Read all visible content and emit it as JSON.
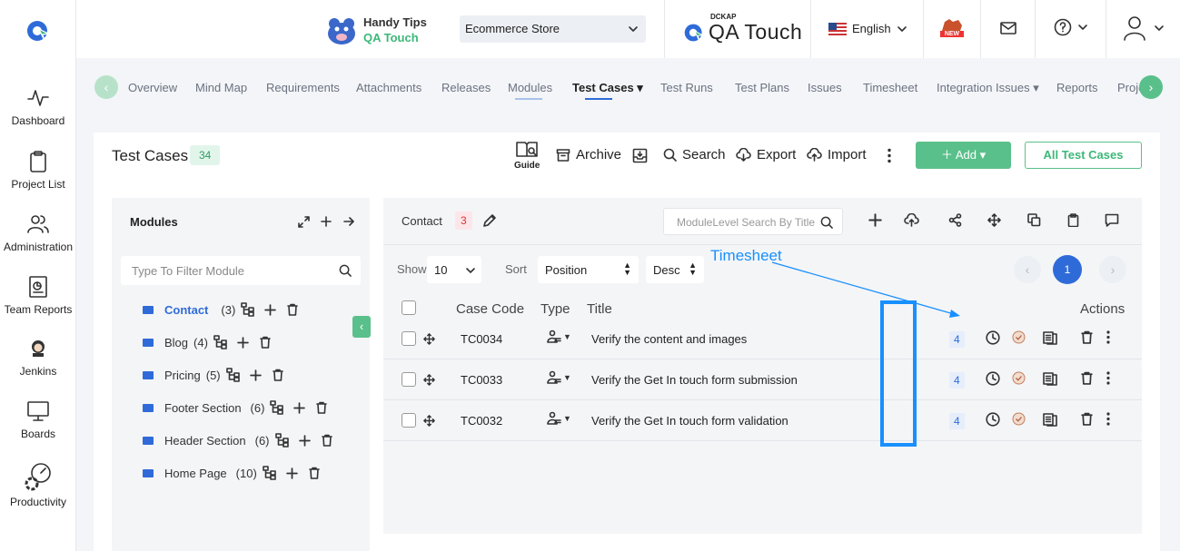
{
  "sidebar": {
    "items": [
      {
        "label": "Dashboard",
        "icon": "activity-icon"
      },
      {
        "label": "Project List",
        "icon": "clipboard-icon"
      },
      {
        "label": "Administration",
        "icon": "users-icon"
      },
      {
        "label": "Team Reports",
        "icon": "report-icon"
      },
      {
        "label": "Jenkins",
        "icon": "jenkins-icon"
      },
      {
        "label": "Boards",
        "icon": "monitor-icon"
      },
      {
        "label": "Productivity",
        "icon": "productivity-icon"
      }
    ]
  },
  "header": {
    "tips_line1": "Handy Tips",
    "tips_line2": "QA Touch",
    "project": "Ecommerce Store",
    "brand_small": "DCKAP",
    "brand": "QA Touch",
    "language": "English",
    "new_badge": "NEW"
  },
  "tabs": [
    {
      "label": "Overview"
    },
    {
      "label": "Mind Map"
    },
    {
      "label": "Requirements"
    },
    {
      "label": "Attachments"
    },
    {
      "label": "Releases"
    },
    {
      "label": "Modules"
    },
    {
      "label": "Test Cases"
    },
    {
      "label": "Test Runs"
    },
    {
      "label": "Test Plans"
    },
    {
      "label": "Issues"
    },
    {
      "label": "Timesheet"
    },
    {
      "label": "Integration Issues"
    },
    {
      "label": "Reports"
    },
    {
      "label": "Proje"
    }
  ],
  "page": {
    "title": "Test Cases",
    "count": "34",
    "guide": "Guide",
    "archive": "Archive",
    "search": "Search",
    "export": "Export",
    "import": "Import",
    "add": "Add",
    "all_test_cases": "All Test Cases"
  },
  "modules": {
    "title": "Modules",
    "filter_placeholder": "Type To Filter Module",
    "items": [
      {
        "name": "Contact",
        "count": "(3)"
      },
      {
        "name": "Blog",
        "count": "(4)"
      },
      {
        "name": "Pricing",
        "count": "(5)"
      },
      {
        "name": "Footer Section",
        "count": "(6)"
      },
      {
        "name": "Header Section",
        "count": "(6)"
      },
      {
        "name": "Home Page",
        "count": "(10)"
      }
    ]
  },
  "table": {
    "module": "Contact",
    "module_count": "3",
    "search_placeholder": "ModuleLevel Search By Title",
    "show_label": "Show",
    "show_value": "10",
    "sort_label": "Sort",
    "sort_value": "Position",
    "order_value": "Desc",
    "page": "1",
    "columns": {
      "code": "Case Code",
      "type": "Type",
      "title": "Title",
      "actions": "Actions"
    },
    "rows": [
      {
        "code": "TC0034",
        "title": "Verify the content and images",
        "count": "4"
      },
      {
        "code": "TC0033",
        "title": "Verify the Get In touch form submission",
        "count": "4"
      },
      {
        "code": "TC0032",
        "title": "Verify the Get In touch form validation",
        "count": "4"
      }
    ]
  },
  "annotation": {
    "label": "Timesheet"
  },
  "colors": {
    "accent": "#5ac08b",
    "primary": "#2f6bd8",
    "highlight": "#1890ff"
  }
}
